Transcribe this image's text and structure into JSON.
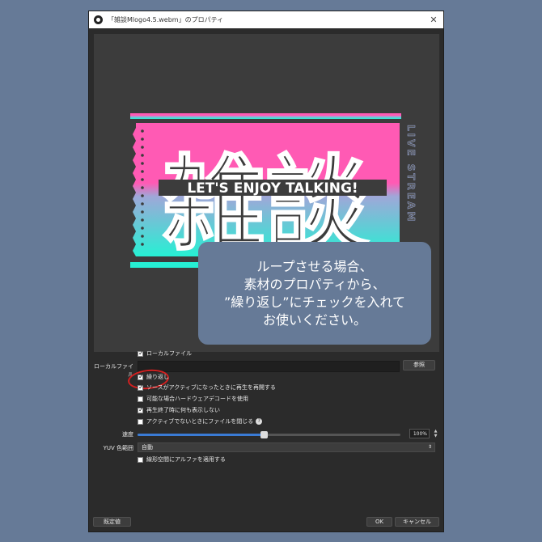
{
  "window": {
    "title": "「雑談Mlogo4.5.webm」のプロパティ",
    "close_glyph": "✕"
  },
  "preview": {
    "top_text": "LET'S ENJOY TALKING!",
    "big_text": "雑談",
    "side_text": "LIVE STREAM",
    "colors": {
      "pink": "#ff5ab4",
      "cyan": "#26f0d4"
    }
  },
  "overlay": {
    "line1": "ループさせる場合、",
    "line2": "素材のプロパティから、",
    "line3": "”繰り返し”にチェックを入れて",
    "line4": "お使いください。"
  },
  "settings": {
    "local_file_checkbox": {
      "label": "ローカルファイル",
      "checked": true
    },
    "local_file_label": "ローカルファイル",
    "browse_button": "参照",
    "options": [
      {
        "label": "繰り返し",
        "checked": true
      },
      {
        "label": "ソースがアクティブになったときに再生を再開する",
        "checked": true
      },
      {
        "label": "可能な場合ハードウェアデコードを使用",
        "checked": false
      },
      {
        "label": "再生終了時に何も表示しない",
        "checked": true
      },
      {
        "label": "アクティブでないときにファイルを閉じる",
        "checked": false
      }
    ],
    "help_glyph": "?",
    "speed_label": "速度",
    "speed_value": "100%",
    "speed_percent": 48,
    "yuv_label": "YUV 色範囲",
    "yuv_value": "自動",
    "linear_alpha": {
      "label": "線形空間にアルファを適用する",
      "checked": false
    }
  },
  "footer": {
    "defaults_button": "既定値",
    "ok_button": "OK",
    "cancel_button": "キャンセル"
  },
  "colors": {
    "background": "#667a97",
    "window_bg": "#2b2b2b",
    "annotation_red": "#d42020",
    "slider_blue": "#3a7bd5"
  }
}
